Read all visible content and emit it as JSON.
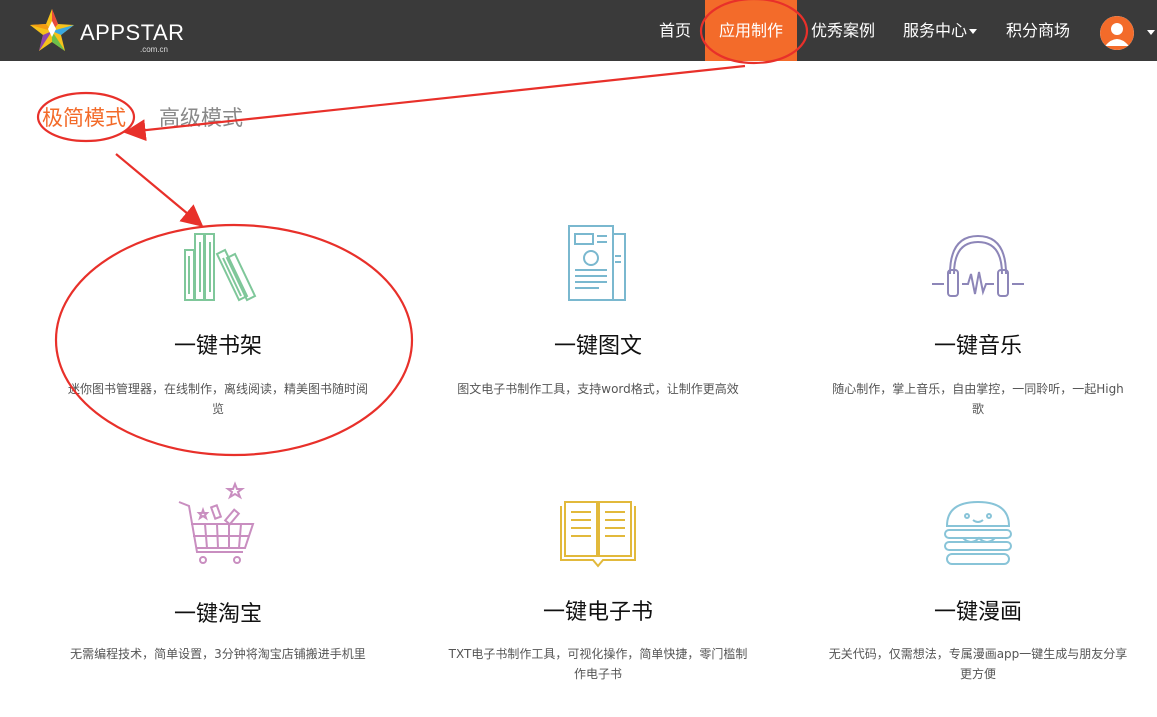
{
  "header": {
    "logo_text": "APPSTAR",
    "logo_sub": ".com.cn",
    "nav": [
      {
        "label": "首页"
      },
      {
        "label": "应用制作"
      },
      {
        "label": "优秀案例"
      },
      {
        "label": "服务中心"
      },
      {
        "label": "积分商场"
      }
    ]
  },
  "tabs": {
    "simple": "极简模式",
    "advanced": "高级模式"
  },
  "cards": [
    {
      "title": "一键书架",
      "desc": "迷你图书管理器，在线制作，离线阅读，精美图书随时阅览",
      "icon": "bookshelf-icon"
    },
    {
      "title": "一键图文",
      "desc": "图文电子书制作工具，支持word格式，让制作更高效",
      "icon": "document-icon"
    },
    {
      "title": "一键音乐",
      "desc": "随心制作，掌上音乐，自由掌控，一同聆听，一起High歌",
      "icon": "headphones-icon"
    },
    {
      "title": "一键淘宝",
      "desc": "无需编程技术，简单设置，3分钟将淘宝店铺搬进手机里",
      "icon": "shopping-cart-icon"
    },
    {
      "title": "一键电子书",
      "desc": "TXT电子书制作工具，可视化操作，简单快捷，零门槛制作电子书",
      "icon": "open-book-icon"
    },
    {
      "title": "一键漫画",
      "desc": "无关代码，仅需想法，专属漫画app一键生成与朋友分享更方便",
      "icon": "burger-icon"
    }
  ],
  "colors": {
    "accent": "#f36b2a",
    "topbar": "#3a3a3a",
    "annotation": "#e8302a"
  }
}
